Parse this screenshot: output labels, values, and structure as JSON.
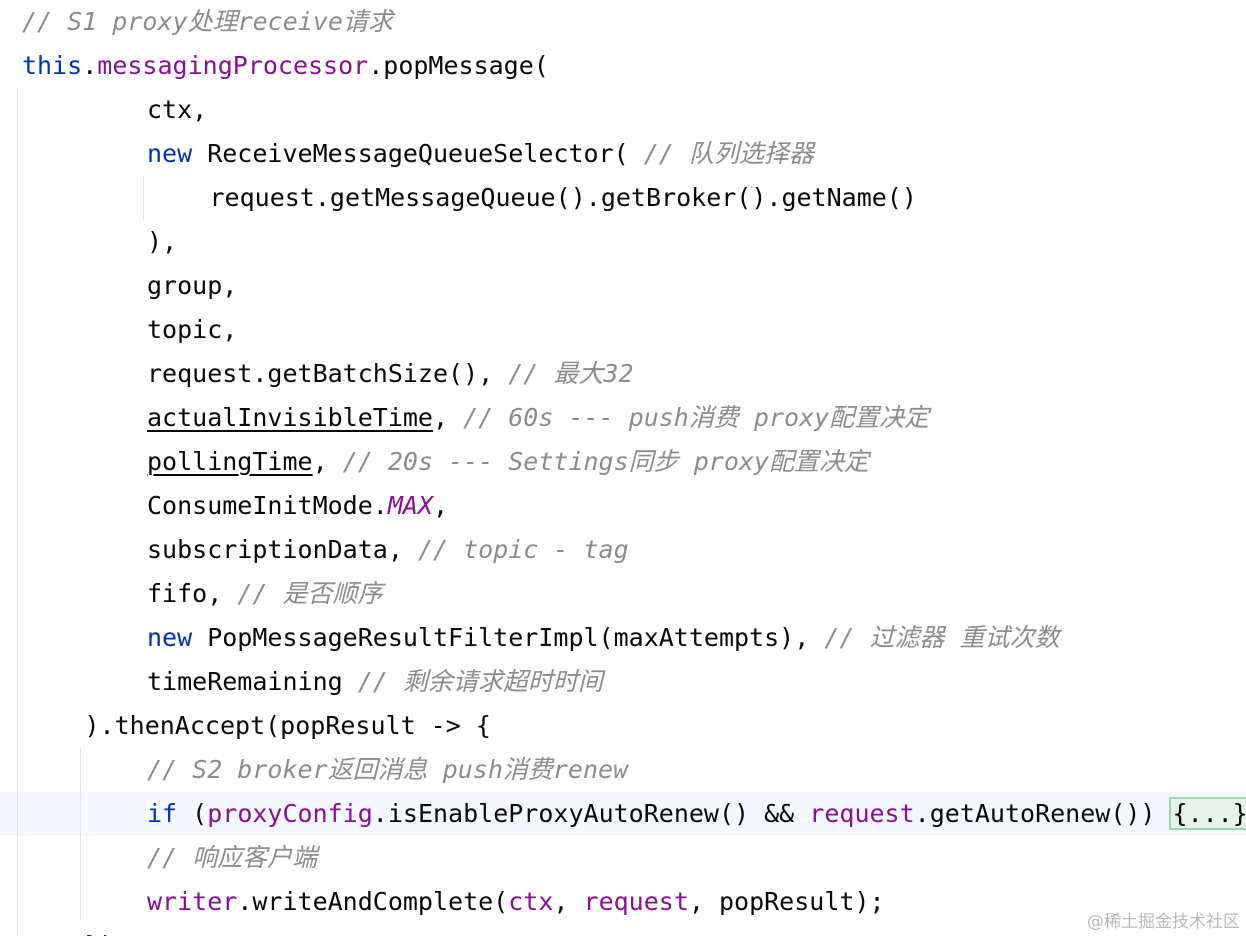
{
  "code_lines": [
    {
      "indent": 0,
      "tokens": [
        {
          "t": "// S1 proxy处理receive请求",
          "c": "cm"
        }
      ]
    },
    {
      "indent": 0,
      "tokens": [
        {
          "t": "this",
          "c": "kw"
        },
        {
          "t": ".",
          "c": ""
        },
        {
          "t": "messagingProcessor",
          "c": "field"
        },
        {
          "t": ".popMessage(",
          "c": ""
        }
      ]
    },
    {
      "indent": 2,
      "tokens": [
        {
          "t": "ctx,",
          "c": ""
        }
      ]
    },
    {
      "indent": 2,
      "tokens": [
        {
          "t": "new",
          "c": "kw"
        },
        {
          "t": " ReceiveMessageQueueSelector( ",
          "c": ""
        },
        {
          "t": "// 队列选择器",
          "c": "cm"
        }
      ]
    },
    {
      "indent": 3,
      "tokens": [
        {
          "t": "request.getMessageQueue().getBroker().getName()",
          "c": ""
        }
      ]
    },
    {
      "indent": 2,
      "tokens": [
        {
          "t": "),",
          "c": ""
        }
      ]
    },
    {
      "indent": 2,
      "tokens": [
        {
          "t": "group,",
          "c": ""
        }
      ]
    },
    {
      "indent": 2,
      "tokens": [
        {
          "t": "topic,",
          "c": ""
        }
      ]
    },
    {
      "indent": 2,
      "tokens": [
        {
          "t": "request.getBatchSize(), ",
          "c": ""
        },
        {
          "t": "// 最大32",
          "c": "cm"
        }
      ]
    },
    {
      "indent": 2,
      "tokens": [
        {
          "t": "actualInvisibleTime",
          "c": "ul"
        },
        {
          "t": ", ",
          "c": ""
        },
        {
          "t": "// 60s --- push消费 proxy配置决定",
          "c": "cm"
        }
      ]
    },
    {
      "indent": 2,
      "tokens": [
        {
          "t": "pollingTime",
          "c": "ul"
        },
        {
          "t": ", ",
          "c": ""
        },
        {
          "t": "// 20s --- Settings同步 proxy配置决定",
          "c": "cm"
        }
      ]
    },
    {
      "indent": 2,
      "tokens": [
        {
          "t": "ConsumeInitMode.",
          "c": ""
        },
        {
          "t": "MAX",
          "c": "static"
        },
        {
          "t": ",",
          "c": ""
        }
      ]
    },
    {
      "indent": 2,
      "tokens": [
        {
          "t": "subscriptionData, ",
          "c": ""
        },
        {
          "t": "// topic - tag",
          "c": "cm"
        }
      ]
    },
    {
      "indent": 2,
      "tokens": [
        {
          "t": "fifo, ",
          "c": ""
        },
        {
          "t": "// 是否顺序",
          "c": "cm"
        }
      ]
    },
    {
      "indent": 2,
      "tokens": [
        {
          "t": "new",
          "c": "kw"
        },
        {
          "t": " PopMessageResultFilterImpl(maxAttempts), ",
          "c": ""
        },
        {
          "t": "// 过滤器 重试次数",
          "c": "cm"
        }
      ]
    },
    {
      "indent": 2,
      "tokens": [
        {
          "t": "timeRemaining ",
          "c": ""
        },
        {
          "t": "// 剩余请求超时时间",
          "c": "cm"
        }
      ]
    },
    {
      "indent": 1,
      "tokens": [
        {
          "t": ").thenAccept(popResult -> {",
          "c": ""
        }
      ]
    },
    {
      "indent": 2,
      "tokens": [
        {
          "t": "// S2 broker返回消息 push消费renew",
          "c": "cm"
        }
      ]
    },
    {
      "indent": 2,
      "tokens": [
        {
          "t": "if",
          "c": "kw"
        },
        {
          "t": " (",
          "c": ""
        },
        {
          "t": "proxyConfig",
          "c": "field"
        },
        {
          "t": ".isEnableProxyAutoRenew() && ",
          "c": ""
        },
        {
          "t": "request",
          "c": "field"
        },
        {
          "t": ".getAutoRenew()) ",
          "c": ""
        },
        {
          "t": "{...}",
          "c": "fold"
        }
      ]
    },
    {
      "indent": 2,
      "tokens": [
        {
          "t": "// 响应客户端",
          "c": "cm"
        }
      ]
    },
    {
      "indent": 2,
      "tokens": [
        {
          "t": "writer",
          "c": "field"
        },
        {
          "t": ".writeAndComplete(",
          "c": ""
        },
        {
          "t": "ctx",
          "c": "field"
        },
        {
          "t": ", ",
          "c": ""
        },
        {
          "t": "request",
          "c": "field"
        },
        {
          "t": ", popResult);",
          "c": ""
        }
      ]
    },
    {
      "indent": 1,
      "tokens": [
        {
          "t": "});",
          "c": ""
        }
      ]
    }
  ],
  "watermark": "@稀土掘金技术社区"
}
